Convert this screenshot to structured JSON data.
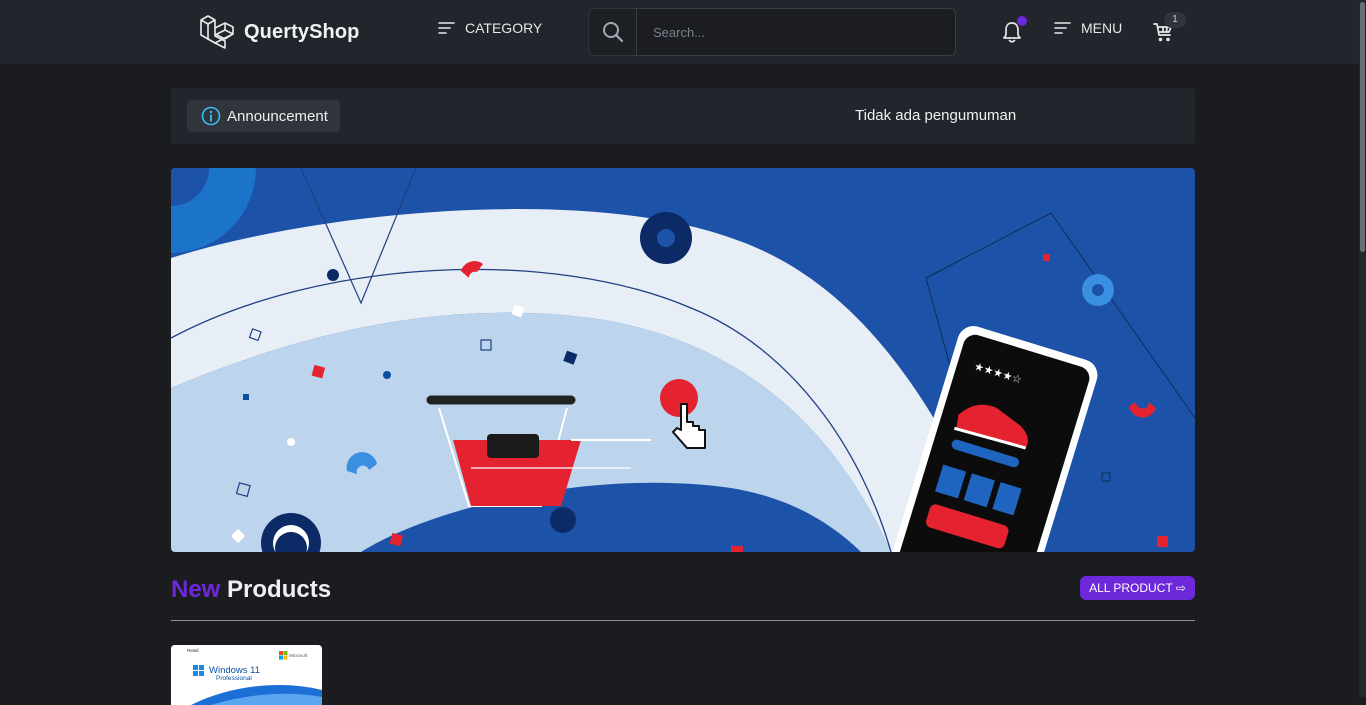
{
  "navbar": {
    "brand_name": "QuertyShop",
    "category_label": "CATEGORY",
    "search_placeholder": "Search...",
    "menu_label": "MENU",
    "cart_count": "1",
    "notification_dot_color": "#6d28d9"
  },
  "announcement": {
    "chip_label": "Announcement",
    "message": "Tidak ada pengumuman"
  },
  "products_section": {
    "title_accent": "New",
    "title_main": "Products",
    "all_product_label": "ALL PRODUCT ⇨",
    "products": [
      {
        "image_brand": "Microsoft",
        "image_title": "Windows 11",
        "image_subtitle": "Professional",
        "image_corner_label": "Retail"
      }
    ]
  },
  "colors": {
    "accent": "#6d28d9",
    "navbar_bg": "#22252b",
    "page_bg": "#1a1c20"
  },
  "icons": [
    "laravel-logo-icon",
    "lines-icon",
    "search-icon",
    "bell-icon",
    "menu-lines-icon",
    "cart-icon",
    "info-icon"
  ]
}
